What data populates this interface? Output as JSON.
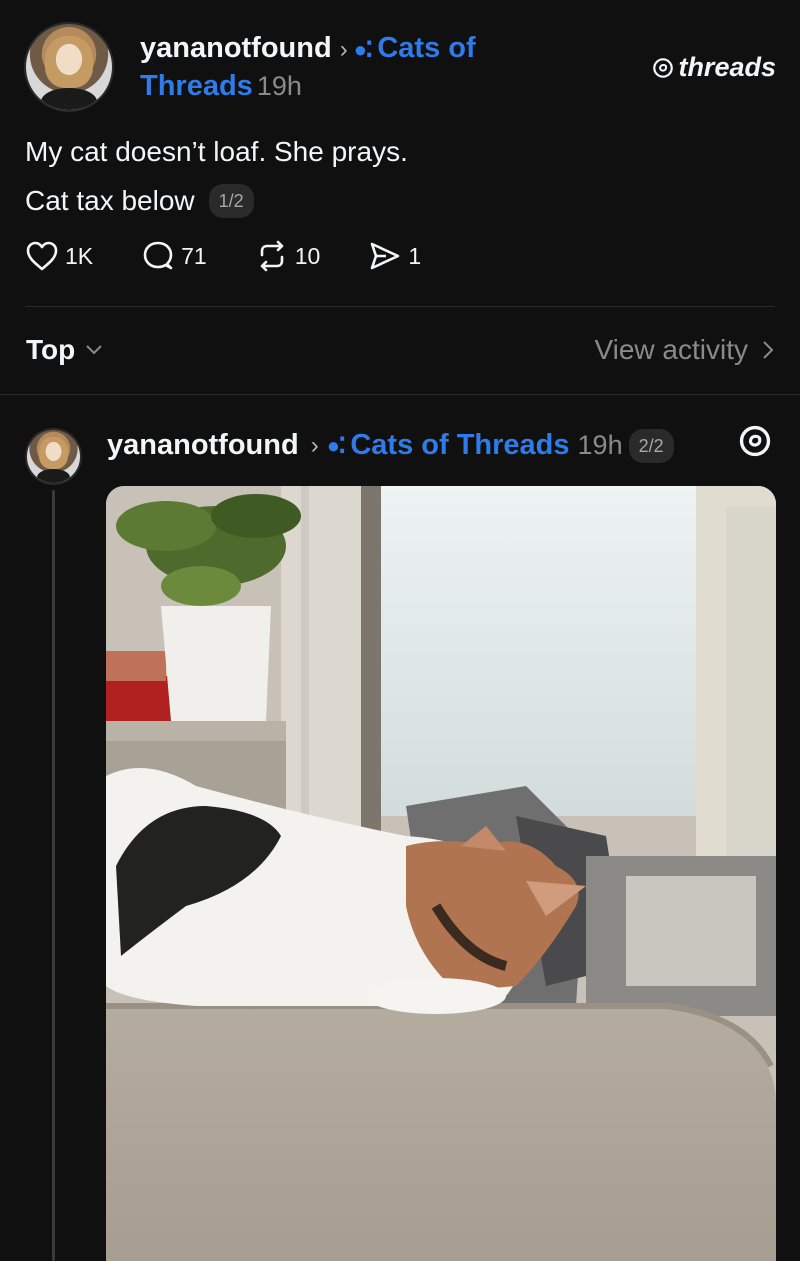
{
  "post": {
    "username": "yananotfound",
    "community": "Cats of Threads",
    "community_line1": "Cats of",
    "community_line2": "Threads",
    "time": "19h",
    "text_line1": "My cat doesn’t loaf. She prays.",
    "text_line2": "Cat tax below",
    "page_indicator": "1/2",
    "likes": "1K",
    "replies": "71",
    "reposts": "10",
    "shares": "1"
  },
  "watermark": "threads",
  "sort": {
    "label": "Top",
    "activity": "View activity"
  },
  "reply": {
    "username": "yananotfound",
    "community": "Cats of Threads",
    "time": "19h",
    "page_indicator": "2/2"
  },
  "colors": {
    "background": "#101010",
    "accent": "#2e7be9",
    "muted": "#8a8a8a"
  },
  "icons": [
    "heart-icon",
    "reply-icon",
    "repost-icon",
    "share-icon",
    "threads-logo-icon",
    "chevron-right-icon",
    "chevron-down-icon"
  ]
}
